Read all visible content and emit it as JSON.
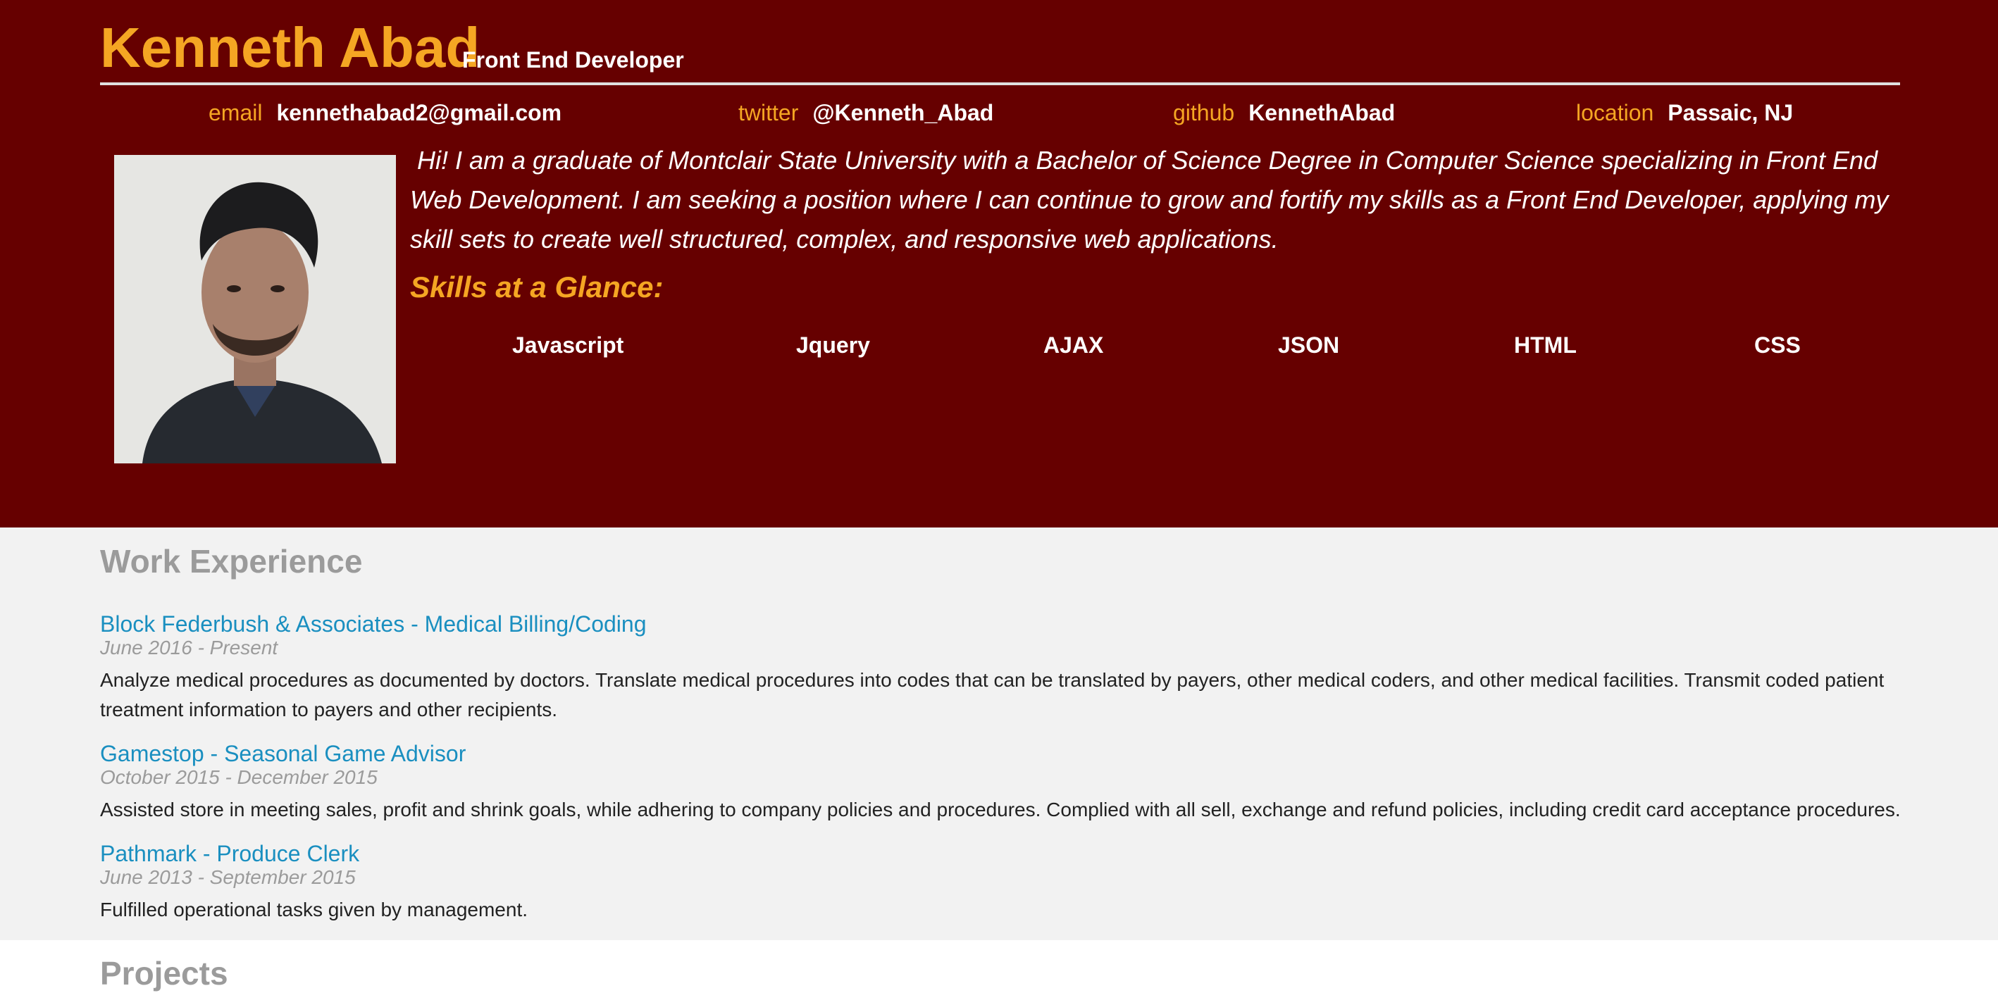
{
  "header": {
    "name": "Kenneth Abad",
    "role": "Front End Developer"
  },
  "contact": [
    {
      "label": "email",
      "value": "kennethabad2@gmail.com"
    },
    {
      "label": "twitter",
      "value": "@Kenneth_Abad"
    },
    {
      "label": "github",
      "value": "KennethAbad"
    },
    {
      "label": "location",
      "value": "Passaic, NJ"
    }
  ],
  "intro": {
    "text": "Hi! I am a graduate of Montclair State University with a Bachelor of Science Degree in Computer Science specializing in Front End Web Development. I am seeking a position where I can continue to grow and fortify my skills as a Front End Developer, applying my skill sets to create well structured, complex, and responsive web applications."
  },
  "skills": {
    "title": "Skills at a Glance:",
    "items": [
      "Javascript",
      "Jquery",
      "AJAX",
      "JSON",
      "HTML",
      "CSS"
    ]
  },
  "work": {
    "title": "Work Experience",
    "jobs": [
      {
        "title": "Block Federbush & Associates - Medical Billing/Coding",
        "dates": "June 2016 - Present",
        "description": "Analyze medical procedures as documented by doctors. Translate medical procedures into codes that can be translated by payers, other medical coders, and other medical facilities. Transmit coded patient treatment information to payers and other recipients."
      },
      {
        "title": "Gamestop - Seasonal Game Advisor",
        "dates": "October 2015 - December 2015",
        "description": "Assisted store in meeting sales, profit and shrink goals, while adhering to company policies and procedures. Complied with all sell, exchange and refund policies, including credit card acceptance procedures."
      },
      {
        "title": "Pathmark - Produce Clerk",
        "dates": "June 2013 - September 2015",
        "description": "Fulfilled operational tasks given by management."
      }
    ]
  },
  "projects": {
    "title": "Projects"
  },
  "colors": {
    "header_bg": "#660000",
    "accent": "#f5a623",
    "link": "#1a8fc0",
    "work_bg": "#f2f2f2"
  }
}
